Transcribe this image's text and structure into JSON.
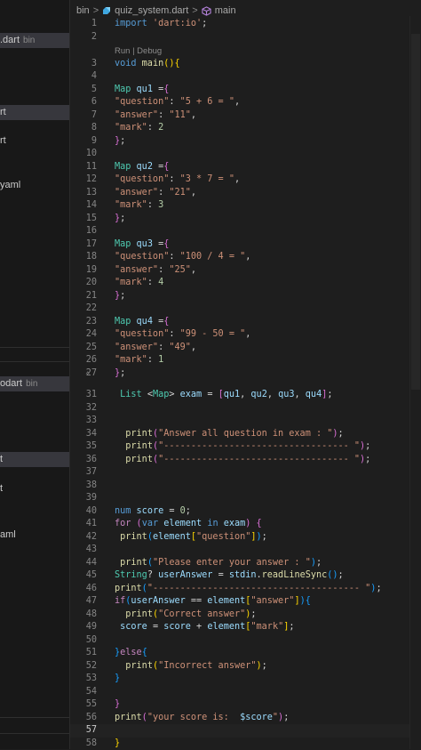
{
  "sidebar": {
    "items": [
      {
        "label": ".dart",
        "hint": "bin",
        "selected": true
      },
      {
        "label": "rt",
        "hint": "",
        "selected": true
      },
      {
        "label": "rt",
        "hint": "",
        "selected": false
      },
      {
        "label": "yaml",
        "hint": "",
        "selected": false
      },
      {
        "label": "odart",
        "hint": "bin",
        "selected": true
      },
      {
        "label": "t",
        "hint": "",
        "selected": true
      },
      {
        "label": "t",
        "hint": "",
        "selected": false
      },
      {
        "label": "aml",
        "hint": "",
        "selected": false
      }
    ]
  },
  "breadcrumb": {
    "folder": "bin",
    "file": "quiz_system.dart",
    "symbol": "main"
  },
  "codelens": "Run | Debug",
  "lines": [
    {
      "n": "1",
      "t": [
        [
          "k",
          "import "
        ],
        [
          "s",
          "'dart:io'"
        ],
        [
          "p",
          ";"
        ]
      ]
    },
    {
      "n": "2",
      "t": []
    },
    {
      "n": "3",
      "t": [
        [
          "k",
          "void "
        ],
        [
          "f",
          "main"
        ],
        [
          "b1",
          "()"
        ],
        [
          "b1",
          "{"
        ]
      ]
    },
    {
      "n": "4",
      "t": []
    },
    {
      "n": "5",
      "t": [
        [
          "t",
          "Map "
        ],
        [
          "v",
          "qu1 "
        ],
        [
          "p",
          "="
        ],
        [
          "b2",
          "{"
        ]
      ]
    },
    {
      "n": "6",
      "t": [
        [
          "s",
          "\"question\""
        ],
        [
          "p",
          ": "
        ],
        [
          "s",
          "\"5 + 6 = \""
        ],
        [
          "p",
          ","
        ]
      ]
    },
    {
      "n": "7",
      "t": [
        [
          "s",
          "\"answer\""
        ],
        [
          "p",
          ": "
        ],
        [
          "s",
          "\"11\""
        ],
        [
          "p",
          ","
        ]
      ]
    },
    {
      "n": "8",
      "t": [
        [
          "s",
          "\"mark\""
        ],
        [
          "p",
          ": "
        ],
        [
          "n",
          "2"
        ]
      ]
    },
    {
      "n": "9",
      "t": [
        [
          "b2",
          "}"
        ],
        [
          "p",
          ";"
        ]
      ]
    },
    {
      "n": "10",
      "t": []
    },
    {
      "n": "11",
      "t": [
        [
          "t",
          "Map "
        ],
        [
          "v",
          "qu2 "
        ],
        [
          "p",
          "="
        ],
        [
          "b2",
          "{"
        ]
      ]
    },
    {
      "n": "12",
      "t": [
        [
          "s",
          "\"question\""
        ],
        [
          "p",
          ": "
        ],
        [
          "s",
          "\"3 * 7 = \""
        ],
        [
          "p",
          ","
        ]
      ]
    },
    {
      "n": "13",
      "t": [
        [
          "s",
          "\"answer\""
        ],
        [
          "p",
          ": "
        ],
        [
          "s",
          "\"21\""
        ],
        [
          "p",
          ","
        ]
      ]
    },
    {
      "n": "14",
      "t": [
        [
          "s",
          "\"mark\""
        ],
        [
          "p",
          ": "
        ],
        [
          "n",
          "3"
        ]
      ]
    },
    {
      "n": "15",
      "t": [
        [
          "b2",
          "}"
        ],
        [
          "p",
          ";"
        ]
      ]
    },
    {
      "n": "16",
      "t": []
    },
    {
      "n": "17",
      "t": [
        [
          "t",
          "Map "
        ],
        [
          "v",
          "qu3 "
        ],
        [
          "p",
          "="
        ],
        [
          "b2",
          "{"
        ]
      ]
    },
    {
      "n": "18",
      "t": [
        [
          "s",
          "\"question\""
        ],
        [
          "p",
          ": "
        ],
        [
          "s",
          "\"100 / 4 = \""
        ],
        [
          "p",
          ","
        ]
      ]
    },
    {
      "n": "19",
      "t": [
        [
          "s",
          "\"answer\""
        ],
        [
          "p",
          ": "
        ],
        [
          "s",
          "\"25\""
        ],
        [
          "p",
          ","
        ]
      ]
    },
    {
      "n": "20",
      "t": [
        [
          "s",
          "\"mark\""
        ],
        [
          "p",
          ": "
        ],
        [
          "n",
          "4"
        ]
      ]
    },
    {
      "n": "21",
      "t": [
        [
          "b2",
          "}"
        ],
        [
          "p",
          ";"
        ]
      ]
    },
    {
      "n": "22",
      "t": []
    },
    {
      "n": "23",
      "t": [
        [
          "t",
          "Map "
        ],
        [
          "v",
          "qu4 "
        ],
        [
          "p",
          "="
        ],
        [
          "b2",
          "{"
        ]
      ]
    },
    {
      "n": "24",
      "t": [
        [
          "s",
          "\"question\""
        ],
        [
          "p",
          ": "
        ],
        [
          "s",
          "\"99 - 50 = \""
        ],
        [
          "p",
          ","
        ]
      ]
    },
    {
      "n": "25",
      "t": [
        [
          "s",
          "\"answer\""
        ],
        [
          "p",
          ": "
        ],
        [
          "s",
          "\"49\""
        ],
        [
          "p",
          ","
        ]
      ]
    },
    {
      "n": "26",
      "t": [
        [
          "s",
          "\"mark\""
        ],
        [
          "p",
          ": "
        ],
        [
          "n",
          "1"
        ]
      ]
    },
    {
      "n": "27",
      "t": [
        [
          "b2",
          "}"
        ],
        [
          "p",
          ";"
        ]
      ]
    },
    {
      "n": "31",
      "t": [
        [
          "p",
          " "
        ],
        [
          "t",
          "List "
        ],
        [
          "p",
          "<"
        ],
        [
          "t",
          "Map"
        ],
        [
          "p",
          "> "
        ],
        [
          "v",
          "exam "
        ],
        [
          "p",
          "= "
        ],
        [
          "b2",
          "["
        ],
        [
          "v",
          "qu1"
        ],
        [
          "p",
          ", "
        ],
        [
          "v",
          "qu2"
        ],
        [
          "p",
          ", "
        ],
        [
          "v",
          "qu3"
        ],
        [
          "p",
          ", "
        ],
        [
          "v",
          "qu4"
        ],
        [
          "b2",
          "]"
        ],
        [
          "p",
          ";"
        ]
      ]
    },
    {
      "n": "32",
      "t": []
    },
    {
      "n": "33",
      "t": []
    },
    {
      "n": "34",
      "t": [
        [
          "p",
          "  "
        ],
        [
          "f",
          "print"
        ],
        [
          "b2",
          "("
        ],
        [
          "s",
          "\"Answer all question in exam : \""
        ],
        [
          "b2",
          ")"
        ],
        [
          "p",
          ";"
        ]
      ]
    },
    {
      "n": "35",
      "t": [
        [
          "p",
          "  "
        ],
        [
          "f",
          "print"
        ],
        [
          "b2",
          "("
        ],
        [
          "s",
          "\"---------------------------------- \""
        ],
        [
          "b2",
          ")"
        ],
        [
          "p",
          ";"
        ]
      ]
    },
    {
      "n": "36",
      "t": [
        [
          "p",
          "  "
        ],
        [
          "f",
          "print"
        ],
        [
          "b2",
          "("
        ],
        [
          "s",
          "\"---------------------------------- \""
        ],
        [
          "b2",
          ")"
        ],
        [
          "p",
          ";"
        ]
      ]
    },
    {
      "n": "37",
      "t": []
    },
    {
      "n": "38",
      "t": []
    },
    {
      "n": "39",
      "t": []
    },
    {
      "n": "40",
      "t": [
        [
          "k",
          "num "
        ],
        [
          "v",
          "score "
        ],
        [
          "p",
          "= "
        ],
        [
          "n",
          "0"
        ],
        [
          "p",
          ";"
        ]
      ]
    },
    {
      "n": "41",
      "t": [
        [
          "c",
          "for "
        ],
        [
          "b2",
          "("
        ],
        [
          "k",
          "var "
        ],
        [
          "v",
          "element "
        ],
        [
          "k",
          "in "
        ],
        [
          "v",
          "exam"
        ],
        [
          "b2",
          ")"
        ],
        [
          "p",
          " "
        ],
        [
          "b2",
          "{"
        ]
      ]
    },
    {
      "n": "42",
      "t": [
        [
          "p",
          " "
        ],
        [
          "f",
          "print"
        ],
        [
          "b3",
          "("
        ],
        [
          "v",
          "element"
        ],
        [
          "b1",
          "["
        ],
        [
          "s",
          "\"question\""
        ],
        [
          "b1",
          "]"
        ],
        [
          "b3",
          ")"
        ],
        [
          "p",
          ";"
        ]
      ]
    },
    {
      "n": "43",
      "t": []
    },
    {
      "n": "44",
      "t": [
        [
          "p",
          " "
        ],
        [
          "f",
          "print"
        ],
        [
          "b3",
          "("
        ],
        [
          "s",
          "\"Please enter your answer : \""
        ],
        [
          "b3",
          ")"
        ],
        [
          "p",
          ";"
        ]
      ]
    },
    {
      "n": "45",
      "t": [
        [
          "t",
          "String"
        ],
        [
          "p",
          "? "
        ],
        [
          "v",
          "userAnswer "
        ],
        [
          "p",
          "= "
        ],
        [
          "v",
          "stdin"
        ],
        [
          "p",
          "."
        ],
        [
          "f",
          "readLineSync"
        ],
        [
          "b3",
          "()"
        ],
        [
          "p",
          ";"
        ]
      ]
    },
    {
      "n": "46",
      "t": [
        [
          "f",
          "print"
        ],
        [
          "b3",
          "("
        ],
        [
          "s",
          "\"-------------------------------------- \""
        ],
        [
          "b3",
          ")"
        ],
        [
          "p",
          ";"
        ]
      ]
    },
    {
      "n": "47",
      "t": [
        [
          "c",
          "if"
        ],
        [
          "b3",
          "("
        ],
        [
          "v",
          "userAnswer "
        ],
        [
          "p",
          "== "
        ],
        [
          "v",
          "element"
        ],
        [
          "b1",
          "["
        ],
        [
          "s",
          "\"answer\""
        ],
        [
          "b1",
          "]"
        ],
        [
          "b3",
          ")"
        ],
        [
          "b3",
          "{"
        ]
      ]
    },
    {
      "n": "48",
      "t": [
        [
          "p",
          "  "
        ],
        [
          "f",
          "print"
        ],
        [
          "b1",
          "("
        ],
        [
          "s",
          "\"Correct answer\""
        ],
        [
          "b1",
          ")"
        ],
        [
          "p",
          ";"
        ]
      ]
    },
    {
      "n": "49",
      "t": [
        [
          "p",
          " "
        ],
        [
          "v",
          "score "
        ],
        [
          "p",
          "= "
        ],
        [
          "v",
          "score "
        ],
        [
          "p",
          "+ "
        ],
        [
          "v",
          "element"
        ],
        [
          "b1",
          "["
        ],
        [
          "s",
          "\"mark\""
        ],
        [
          "b1",
          "]"
        ],
        [
          "p",
          ";"
        ]
      ]
    },
    {
      "n": "50",
      "t": []
    },
    {
      "n": "51",
      "t": [
        [
          "b3",
          "}"
        ],
        [
          "c",
          "else"
        ],
        [
          "b3",
          "{"
        ]
      ]
    },
    {
      "n": "52",
      "t": [
        [
          "p",
          "  "
        ],
        [
          "f",
          "print"
        ],
        [
          "b1",
          "("
        ],
        [
          "s",
          "\"Incorrect answer\""
        ],
        [
          "b1",
          ")"
        ],
        [
          "p",
          ";"
        ]
      ]
    },
    {
      "n": "53",
      "t": [
        [
          "b3",
          "}"
        ]
      ]
    },
    {
      "n": "54",
      "t": []
    },
    {
      "n": "55",
      "t": [
        [
          "b2",
          "}"
        ]
      ]
    },
    {
      "n": "56",
      "t": [
        [
          "f",
          "print"
        ],
        [
          "b2",
          "("
        ],
        [
          "s",
          "\"your score is:  "
        ],
        [
          "v",
          "$score"
        ],
        [
          "s",
          "\""
        ],
        [
          "b2",
          ")"
        ],
        [
          "p",
          ";"
        ]
      ]
    },
    {
      "n": "57",
      "t": []
    },
    {
      "n": "58",
      "t": [
        [
          "b1",
          "}"
        ]
      ]
    }
  ]
}
